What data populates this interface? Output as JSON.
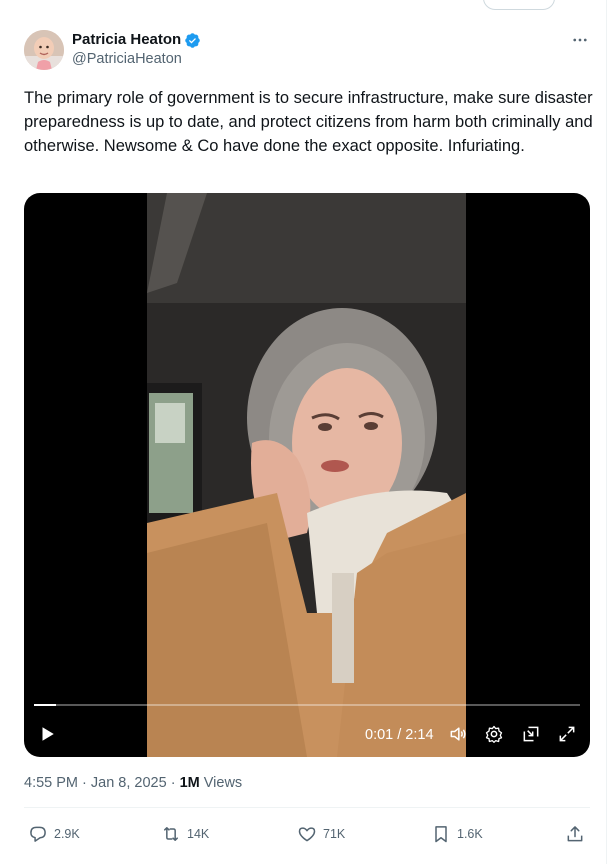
{
  "author": {
    "display_name": "Patricia Heaton",
    "handle": "@PatriciaHeaton",
    "verified": true
  },
  "more_icon": "ellipsis-icon",
  "tweet": {
    "text": "The primary role of government is to secure infrastructure, make sure disaster preparedness is up to date, and protect citizens from harm both criminally and otherwise. Newsome & Co have done the exact opposite. Infuriating."
  },
  "video": {
    "time_display": "0:01 / 2:14",
    "progress": 0.008,
    "controls": [
      "play-icon",
      "volume-icon",
      "settings-icon",
      "pip-icon",
      "fullscreen-icon"
    ]
  },
  "meta": {
    "time": "4:55 PM",
    "separator_1": " · ",
    "date": "Jan 8, 2025",
    "separator_2": " · ",
    "views_count": "1M",
    "views_label": " Views"
  },
  "actions": {
    "replies": "2.9K",
    "reposts": "14K",
    "likes": "71K",
    "bookmarks": "1.6K"
  },
  "colors": {
    "accent": "#1d9bf0",
    "secondary_text": "#536471",
    "primary_text": "#0f1419",
    "divider": "#eff3f4"
  }
}
